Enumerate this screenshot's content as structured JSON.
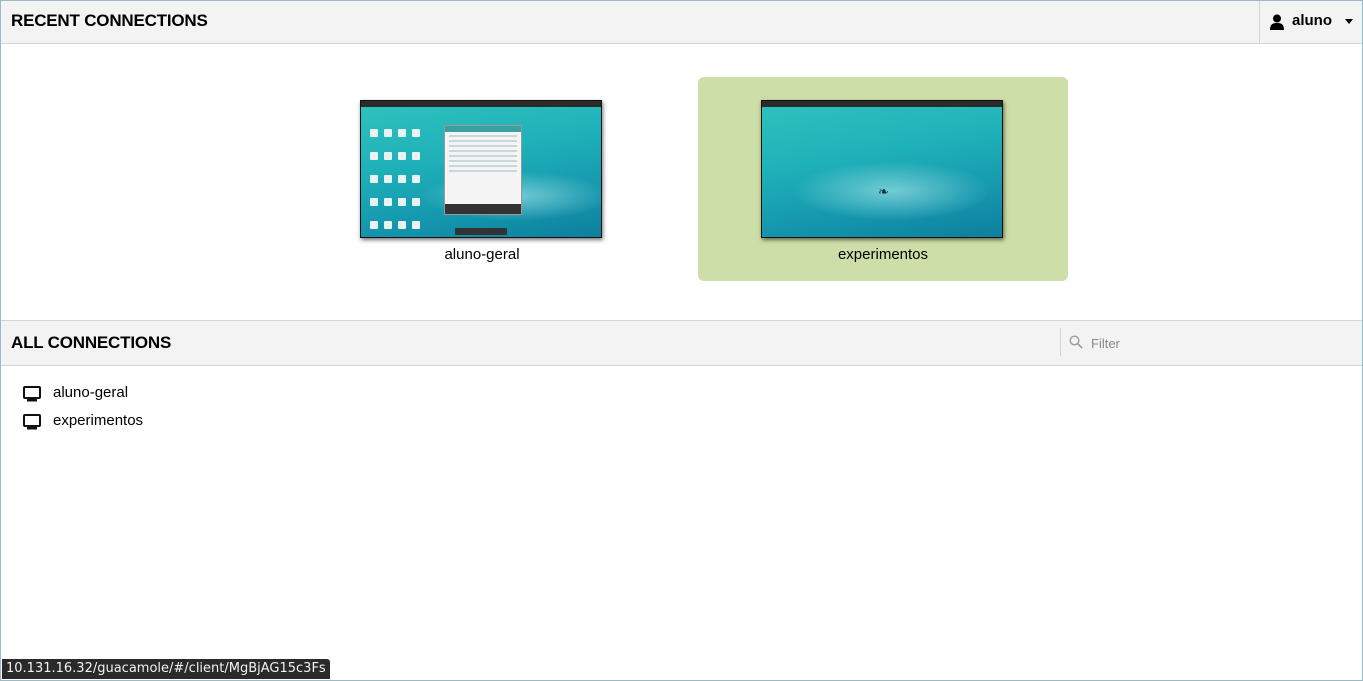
{
  "recent": {
    "title": "RECENT CONNECTIONS",
    "tiles": [
      {
        "label": "aluno-geral"
      },
      {
        "label": "experimentos"
      }
    ]
  },
  "user_menu": {
    "username": "aluno",
    "icon": "user-icon"
  },
  "all": {
    "title": "ALL CONNECTIONS",
    "filter_placeholder": "Filter",
    "connections": [
      {
        "name": "aluno-geral",
        "icon": "monitor-icon"
      },
      {
        "name": "experimentos",
        "icon": "monitor-icon"
      }
    ]
  },
  "status_bar": {
    "url": "10.131.16.32/guacamole/#/client/MgBjAG15c3Fs"
  },
  "colors": {
    "header_bg": "#f3f3f3",
    "selected_tile_bg": "#cedea8",
    "frame_border": "#9bbac4"
  }
}
